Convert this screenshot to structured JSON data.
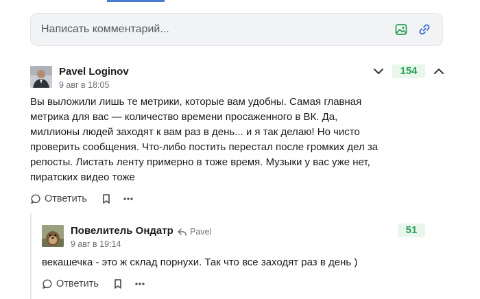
{
  "composer": {
    "placeholder": "Написать комментарий...",
    "image_icon": "image-icon",
    "link_icon": "link-icon"
  },
  "comments": [
    {
      "author": "Pavel Loginov",
      "date": "9 авг в 18:05",
      "rating": "154",
      "text": "Вы выложили лишь те метрики, которые вам удобны. Самая главная метрика для вас — количество времени просаженного в ВК. Да, миллионы людей заходят к вам раз в день... и я так делаю! Но чисто проверить сообщения. Что-либо постить перестал после громких дел за репосты. Листать ленту примерно в тоже время. Музыки у вас уже нет, пиратских видео тоже",
      "reply_label": "Ответить"
    },
    {
      "author": "Повелитель Ондатр",
      "reply_to": "Pavel",
      "date": "9 авг в 19:14",
      "rating": "51",
      "text": "векашечка - это ж склад порнухи. Так что все заходят раз в день )",
      "reply_label": "Ответить"
    }
  ],
  "colors": {
    "accent": "#4a7bd0",
    "rating_bg": "#e8f6ec",
    "rating_text": "#2ca05a",
    "composer_icon": "#2ca05a",
    "link_icon_color": "#3a6fd8"
  }
}
